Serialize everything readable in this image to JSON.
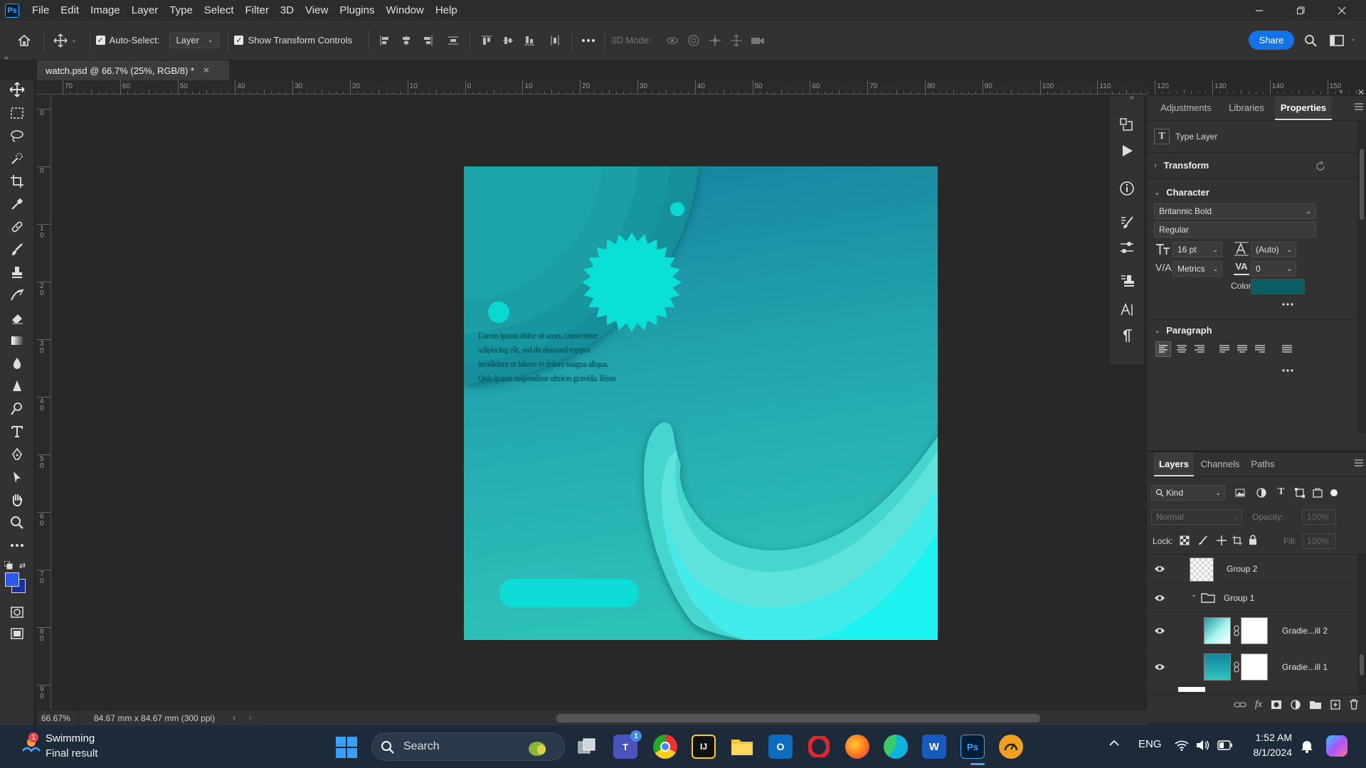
{
  "app": {
    "logo": "Ps"
  },
  "menu": [
    "File",
    "Edit",
    "Image",
    "Layer",
    "Type",
    "Select",
    "Filter",
    "3D",
    "View",
    "Plugins",
    "Window",
    "Help"
  ],
  "options_bar": {
    "auto_select_label": "Auto-Select:",
    "auto_select_target": "Layer",
    "show_transform_label": "Show Transform Controls",
    "mode_3d_label": "3D Mode:",
    "share_label": "Share"
  },
  "document": {
    "tab_title": "watch.psd @ 66.7% (25%, RGB/8) *"
  },
  "ruler": {
    "top": [
      "70",
      "60",
      "50",
      "40",
      "30",
      "20",
      "10",
      "0",
      "10",
      "20",
      "30",
      "40",
      "50",
      "60",
      "70",
      "80",
      "90",
      "100",
      "110",
      "120",
      "130",
      "140",
      "150"
    ],
    "left": [
      "0",
      "0",
      "1 0",
      "2 0",
      "3 0",
      "4 0",
      "5 0",
      "6 0",
      "7 0",
      "8 0",
      "9 0"
    ]
  },
  "canvas": {
    "text_lines": [
      "Lorem ipsum dolor sit amet, consectetur",
      "adipiscing elit, sed do eiusmod tempor",
      "incididunt ut labore et dolore magna aliqua.",
      "Quis ipsum suspendisse ultrices gravida. Risus"
    ]
  },
  "properties_panel": {
    "tabs": [
      "Adjustments",
      "Libraries",
      "Properties"
    ],
    "active_tab": "Properties",
    "layer_kind": "Type Layer",
    "transform_label": "Transform",
    "character_label": "Character",
    "font_family": "Britannic Bold",
    "font_style": "Regular",
    "font_size": "16 pt",
    "leading": "(Auto)",
    "kerning": "Metrics",
    "tracking": "0",
    "color_label": "Color",
    "text_color": "#0a5d62",
    "paragraph_label": "Paragraph"
  },
  "layers_panel": {
    "tabs": [
      "Layers",
      "Channels",
      "Paths"
    ],
    "active_tab": "Layers",
    "filter_kind": "Kind",
    "blend_mode": "Normal",
    "opacity_label": "Opacity:",
    "opacity_value": "100%",
    "lock_label": "Lock:",
    "fill_label": "Fill:",
    "fill_value": "100%",
    "layers": [
      {
        "name": "Group 2",
        "type": "layer"
      },
      {
        "name": "Group 1",
        "type": "group"
      },
      {
        "name": "Gradie...ill 2",
        "type": "fill"
      },
      {
        "name": "Gradie...ill 1",
        "type": "fill"
      }
    ]
  },
  "status_bar": {
    "zoom": "66.67%",
    "doc_size": "84.67 mm x 84.67 mm (300 ppi)"
  },
  "taskbar": {
    "notification_title": "Swimming",
    "notification_subtitle": "Final result",
    "notification_badge": "1",
    "search_label": "Search",
    "teams_badge": "1",
    "language": "ENG",
    "time": "1:52 AM",
    "date": "8/1/2024"
  },
  "colors": {
    "accent_blue": "#1473e6",
    "foreground_swatch": "#2d5ae8",
    "background_swatch": "#1a2fa0"
  }
}
